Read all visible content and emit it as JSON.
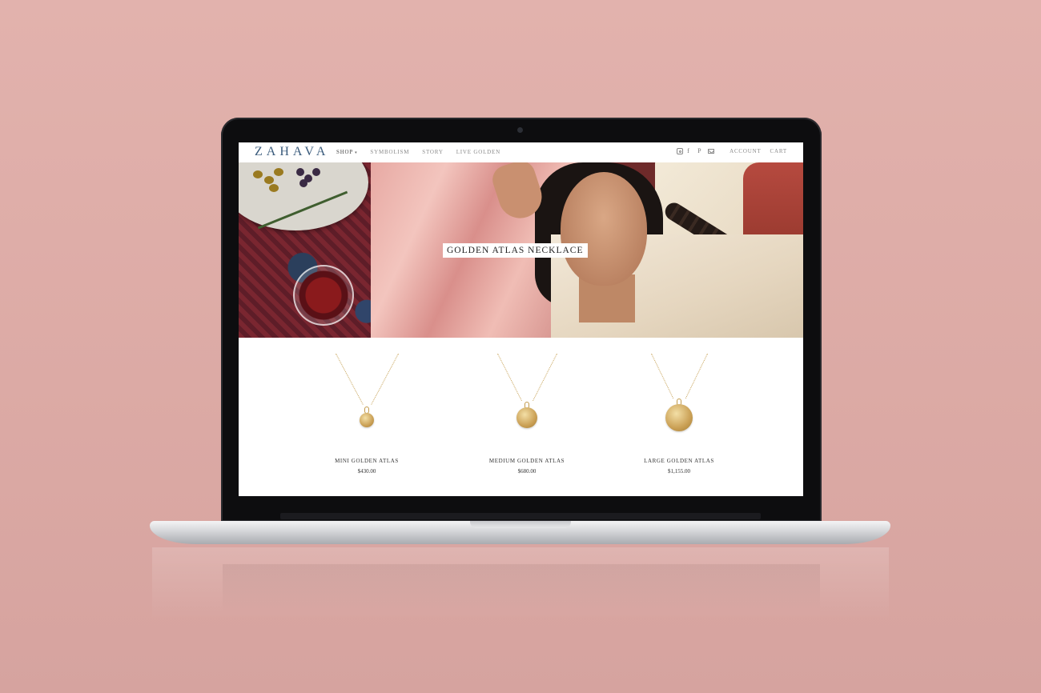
{
  "brand": {
    "logo": "ZAHAVA"
  },
  "nav": {
    "items": [
      {
        "label": "SHOP",
        "has_dropdown": true
      },
      {
        "label": "SYMBOLISM"
      },
      {
        "label": "STORY"
      },
      {
        "label": "LIVE GOLDEN"
      }
    ],
    "caret": "▾"
  },
  "header_right": {
    "icons": [
      "instagram-icon",
      "facebook-icon",
      "pinterest-icon",
      "mail-icon"
    ],
    "facebook_glyph": "f",
    "pinterest_glyph": "P",
    "account_label": "ACCOUNT",
    "cart_label": "CART"
  },
  "hero": {
    "title": "GOLDEN ATLAS NECKLACE"
  },
  "products": [
    {
      "name": "MINI GOLDEN ATLAS",
      "price": "$430.00"
    },
    {
      "name": "MEDIUM GOLDEN ATLAS",
      "price": "$680.00"
    },
    {
      "name": "LARGE GOLDEN ATLAS",
      "price": "$1,155.00"
    }
  ],
  "colors": {
    "background": "#dcaaa5",
    "logo": "#3a5b7c",
    "gold": "#caa055"
  }
}
